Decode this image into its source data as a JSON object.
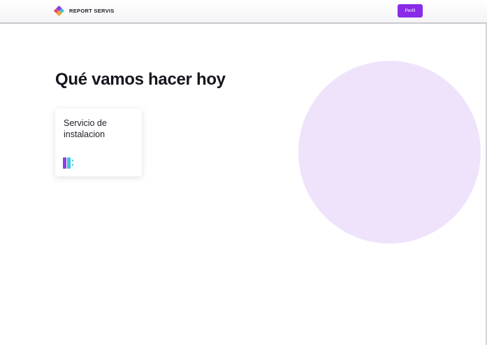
{
  "header": {
    "brand_name": "REPORT SERVIS",
    "logo_icon": "report-servis-logo-icon",
    "profile_button_label": "Perfil"
  },
  "main": {
    "title": "Qué vamos hacer hoy",
    "cards": [
      {
        "title": "Servicio de instalacion",
        "icon": "installation-service-icon"
      }
    ]
  },
  "colors": {
    "accent": "#8a2be8",
    "circle": "#efe3fc",
    "text": "#16161e",
    "icon_purple": "#8b3fe6",
    "icon_teal": "#3cc8d8"
  }
}
